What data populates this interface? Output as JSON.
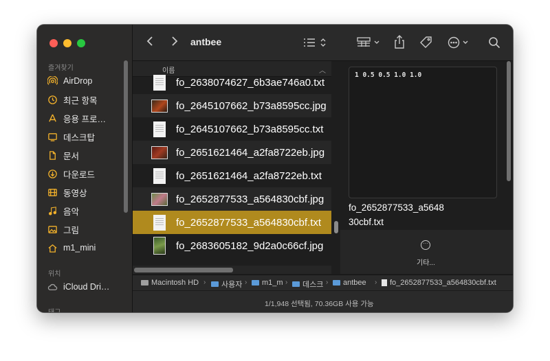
{
  "window_title": "antbee",
  "sidebar": {
    "favorites_label": "즐겨찾기",
    "locations_label": "위치",
    "tags_label": "태그",
    "favorites": [
      {
        "label": "AirDrop",
        "icon": "airdrop-icon"
      },
      {
        "label": "최근 항목",
        "icon": "clock-icon"
      },
      {
        "label": "응용 프로…",
        "icon": "apps-icon"
      },
      {
        "label": "데스크탑",
        "icon": "desktop-icon"
      },
      {
        "label": "문서",
        "icon": "document-icon"
      },
      {
        "label": "다운로드",
        "icon": "download-icon"
      },
      {
        "label": "동영상",
        "icon": "movie-icon"
      },
      {
        "label": "음악",
        "icon": "music-icon"
      },
      {
        "label": "그림",
        "icon": "picture-icon"
      },
      {
        "label": "m1_mini",
        "icon": "home-icon"
      }
    ],
    "locations": [
      {
        "label": "iCloud Dri…",
        "icon": "cloud-icon"
      }
    ]
  },
  "list": {
    "column_header": "이름",
    "files": [
      {
        "name": "fo_2638074627_6b3ae746a0.txt",
        "type": "text"
      },
      {
        "name": "fo_2645107662_b73a8595cc.jpg",
        "type": "image"
      },
      {
        "name": "fo_2645107662_b73a8595cc.txt",
        "type": "text"
      },
      {
        "name": "fo_2651621464_a2fa8722eb.jpg",
        "type": "image"
      },
      {
        "name": "fo_2651621464_a2fa8722eb.txt",
        "type": "text"
      },
      {
        "name": "fo_2652877533_a564830cbf.jpg",
        "type": "image"
      },
      {
        "name": "fo_2652877533_a564830cbf.txt",
        "type": "text",
        "selected": true
      },
      {
        "name": "fo_2683605182_9d2a0c66cf.jpg",
        "type": "image"
      }
    ]
  },
  "preview": {
    "content": "1 0.5 0.5 1.0 1.0",
    "filename": "fo_2652877533_a564830cbf.txt",
    "more_label": "기타..."
  },
  "pathbar": [
    "Macintosh HD",
    "사용자",
    "m1_m",
    "데스크",
    "antbee",
    "fo_2652877533_a564830cbf.txt"
  ],
  "status": "1/1,948 선택됨, 70.36GB 사용 가능",
  "colors": {
    "selection": "#b08a1e",
    "sidebar_icon": "#f2b12b",
    "folder": "#5b9ad8"
  }
}
